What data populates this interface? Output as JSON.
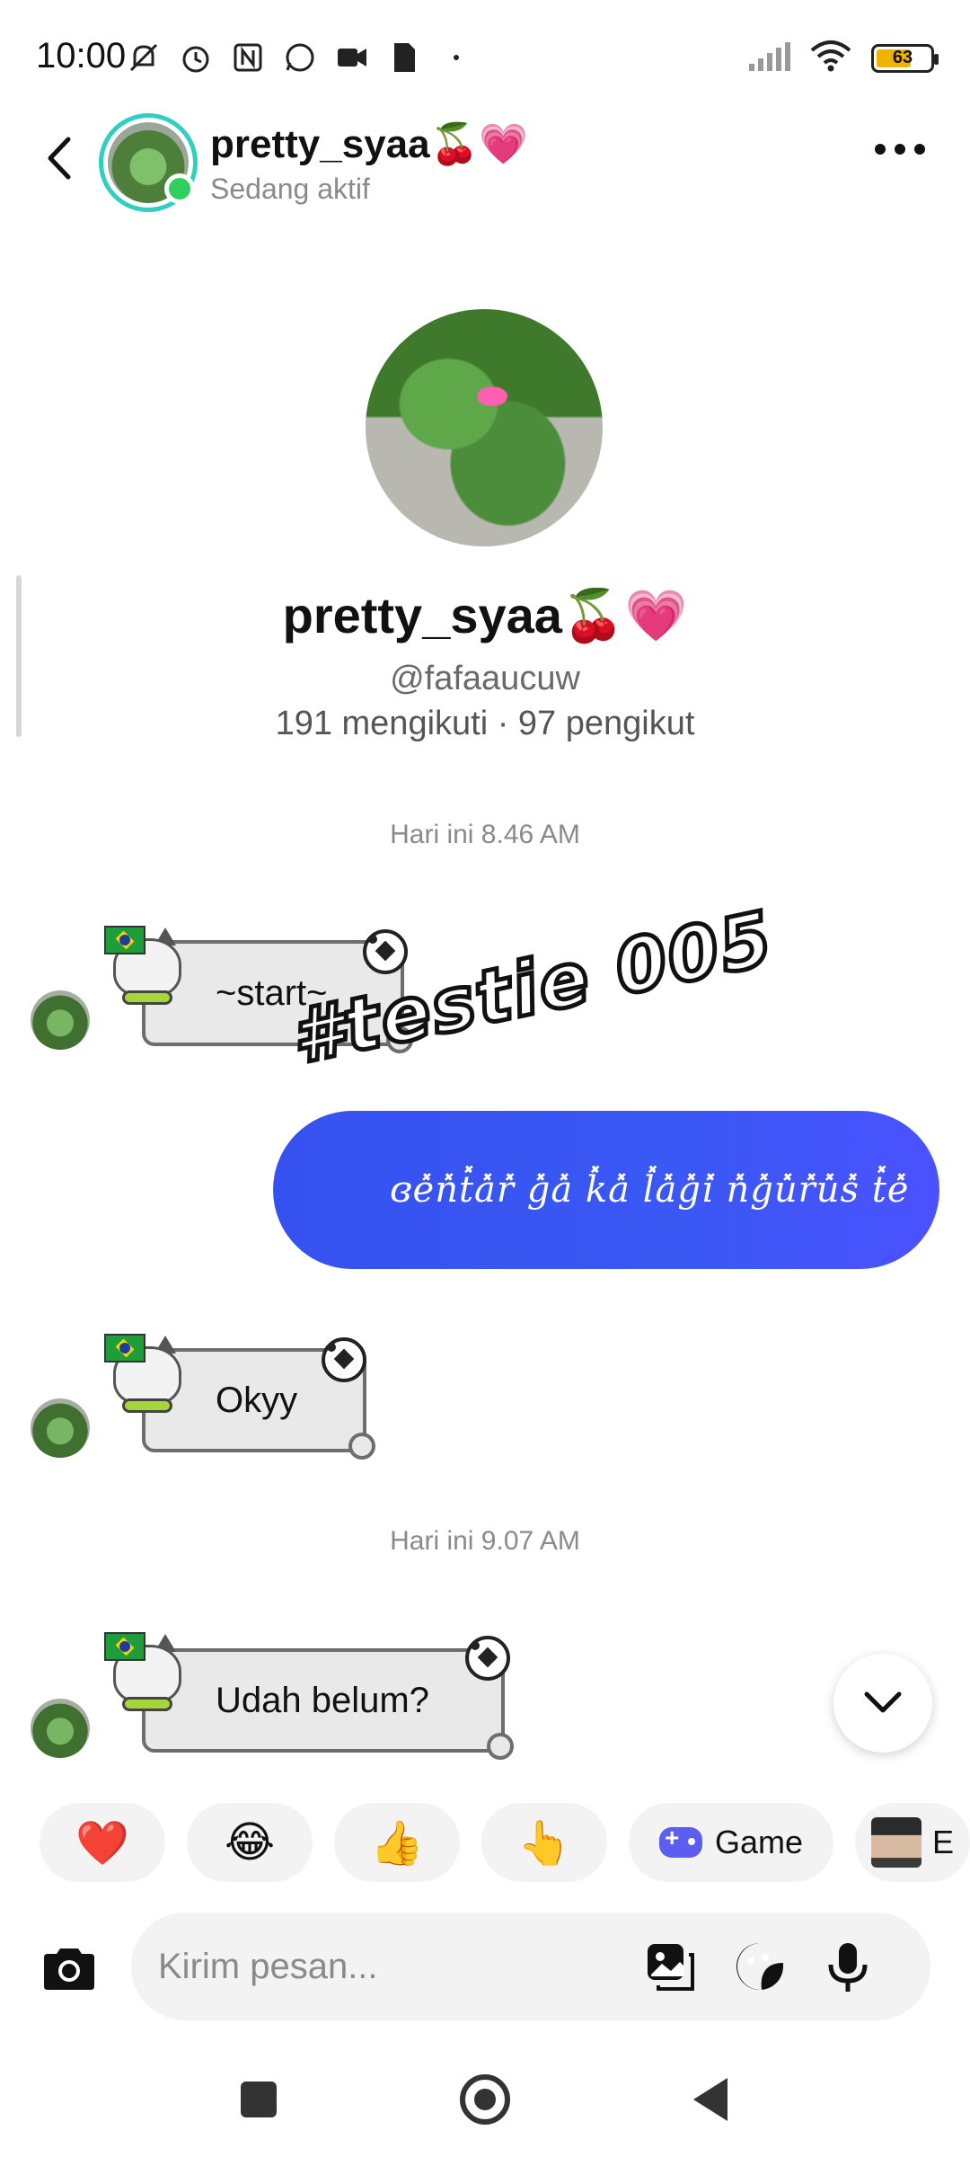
{
  "status_bar": {
    "time": "10:00",
    "battery": "63",
    "icons_left": [
      "mute-bell-icon",
      "alarm-icon",
      "nfc-icon",
      "whatsapp-icon",
      "video-icon",
      "file-icon",
      "dot-icon"
    ],
    "icons_right": [
      "signal-icon",
      "wifi-icon",
      "battery-icon"
    ]
  },
  "header": {
    "name": "pretty_syaa🍒💗",
    "status": "Sedang aktif"
  },
  "profile": {
    "name": "pretty_syaa🍒💗",
    "handle": "@fafaaucuw",
    "stats": "191 mengikuti · 97 pengikut"
  },
  "messages": {
    "timestamp_1": "Hari ini 8.46 AM",
    "incoming_1": "~start~",
    "overlay_text": "#testie 005",
    "outgoing_1": "ɞe̽n̽t̽a̽r̽ g̽a̽ k̽a̽ l̽a̽g̽i̽ n̽g̽u̽r̽u̽s̽ t̽e̽",
    "incoming_2": "Okyy",
    "timestamp_2": "Hari ini 9.07 AM",
    "incoming_3": "Udah belum?"
  },
  "quick_reactions": {
    "items": [
      "❤️",
      "😂",
      "👍",
      "👆"
    ],
    "game_label": "Game",
    "partial_label": "E"
  },
  "composer": {
    "placeholder": "Kirim pesan..."
  },
  "colors": {
    "accent_blue": "#3a58f4",
    "online_green": "#2ecf5e",
    "avatar_ring": "#2fd0c0"
  }
}
